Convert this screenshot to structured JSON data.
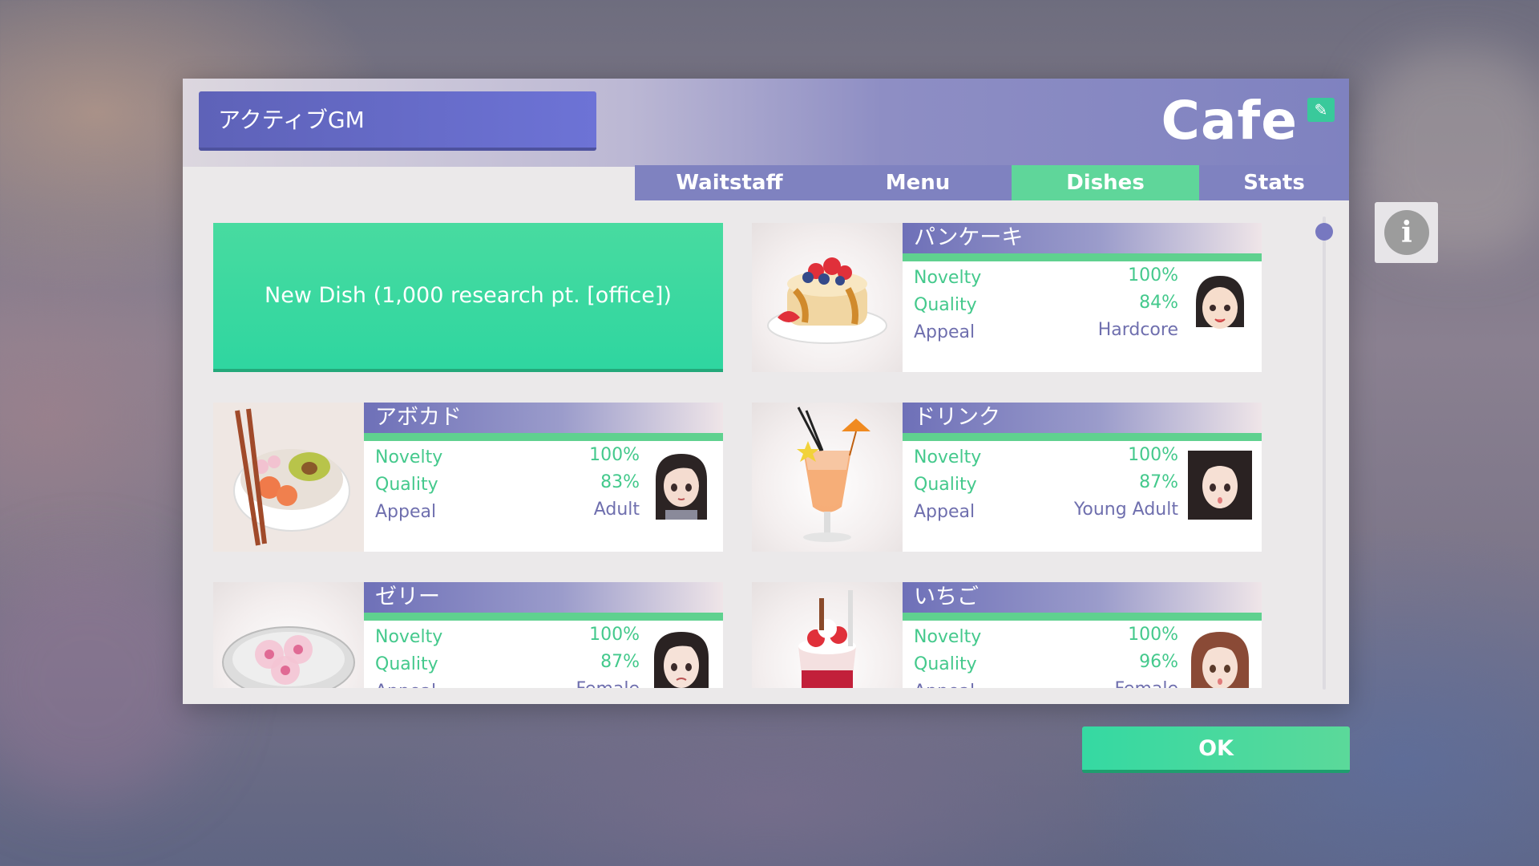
{
  "dialog": {
    "name_field": "アクティブGM",
    "venue_title": "Cafe",
    "edit_icon": "pencil-icon",
    "tabs": [
      {
        "label": "Waitstaff",
        "active": false
      },
      {
        "label": "Menu",
        "active": false
      },
      {
        "label": "Dishes",
        "active": true
      },
      {
        "label": "Stats",
        "active": false
      }
    ],
    "new_dish_label": "New Dish (1,000 research pt. [office])",
    "info_icon": "info-icon",
    "ok_label": "OK"
  },
  "dishes": [
    {
      "name": "パンケーキ",
      "novelty_label": "Novelty",
      "novelty": "100%",
      "quality_label": "Quality",
      "quality": "84%",
      "appeal_label": "Appeal",
      "appeal": "Hardcore"
    },
    {
      "name": "アボカド",
      "novelty_label": "Novelty",
      "novelty": "100%",
      "quality_label": "Quality",
      "quality": "83%",
      "appeal_label": "Appeal",
      "appeal": "Adult"
    },
    {
      "name": "ドリンク",
      "novelty_label": "Novelty",
      "novelty": "100%",
      "quality_label": "Quality",
      "quality": "87%",
      "appeal_label": "Appeal",
      "appeal": "Young Adult"
    },
    {
      "name": "ゼリー",
      "novelty_label": "Novelty",
      "novelty": "100%",
      "quality_label": "Quality",
      "quality": "87%",
      "appeal_label": "Appeal",
      "appeal": "Female"
    },
    {
      "name": "いちご",
      "novelty_label": "Novelty",
      "novelty": "100%",
      "quality_label": "Quality",
      "quality": "96%",
      "appeal_label": "Appeal",
      "appeal": "Female"
    }
  ],
  "colors": {
    "accent_green": "#5fd69a",
    "header_purple": "#7f82c0",
    "stat_green": "#44c98c",
    "stat_purple": "#6f6fae"
  }
}
